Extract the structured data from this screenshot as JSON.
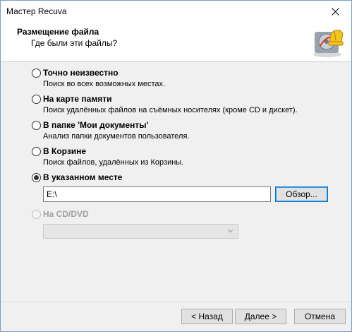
{
  "window": {
    "title": "Мастер Recuva"
  },
  "header": {
    "title": "Размещение файла",
    "subtitle": "Где были эти файлы?"
  },
  "options": [
    {
      "label": "Точно неизвестно",
      "description": "Поиск во всех возможных местах.",
      "checked": false,
      "disabled": false
    },
    {
      "label": "На карте памяти",
      "description": "Поиск удалённых файлов на съёмных носителях (кроме CD и дискет).",
      "checked": false,
      "disabled": false
    },
    {
      "label": "В папке 'Мои документы'",
      "description": "Анализ папки документов пользователя.",
      "checked": false,
      "disabled": false
    },
    {
      "label": "В Корзине",
      "description": "Поиск файлов, удалённых из Корзины.",
      "checked": false,
      "disabled": false
    },
    {
      "label": "В указанном месте",
      "checked": true,
      "disabled": false
    },
    {
      "label": "На CD/DVD",
      "checked": false,
      "disabled": true
    }
  ],
  "path": {
    "value": "E:\\",
    "browse_label": "Обзор..."
  },
  "cd_select": {
    "value": ""
  },
  "buttons": {
    "back": "< Назад",
    "next": "Далее >",
    "cancel": "Отмена"
  },
  "icons": {
    "close": "close-icon",
    "logo": "recuva-logo-icon",
    "select": "chevron-down-icon"
  }
}
